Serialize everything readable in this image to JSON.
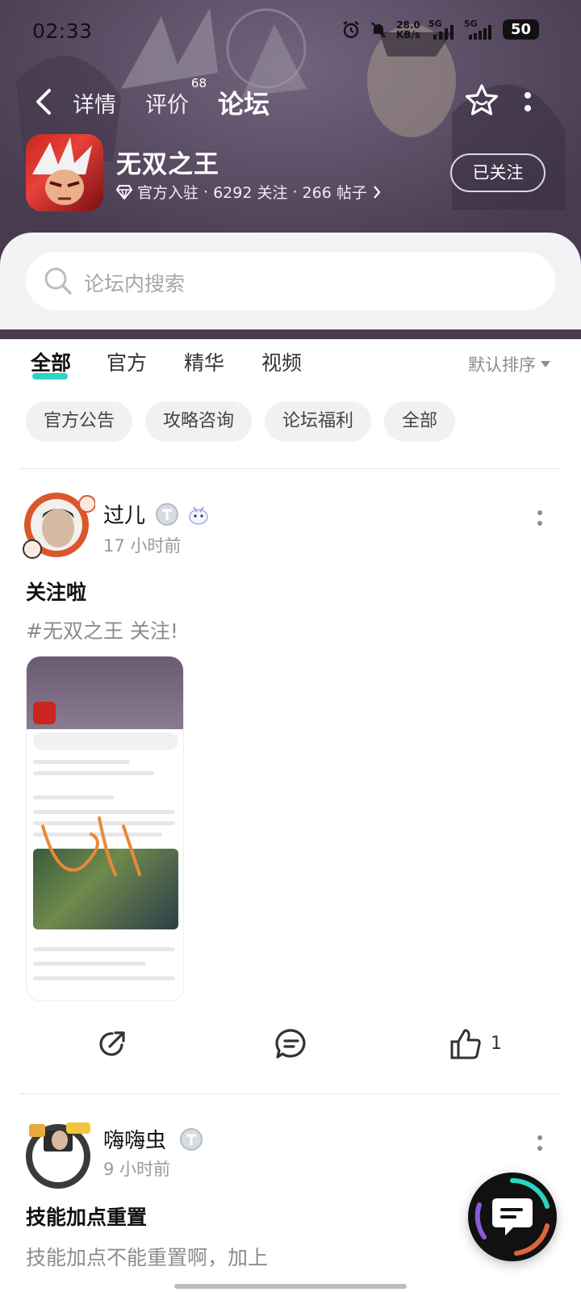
{
  "status_bar": {
    "time": "02:33",
    "net_speed_value": "28.0",
    "net_speed_unit": "KB/s",
    "sim1_label": "5G",
    "sim2_label": "5G",
    "battery": "50",
    "icons": [
      "alarm-icon",
      "mute-bell-icon",
      "signal-icon",
      "signal-icon"
    ]
  },
  "nav": {
    "tabs": [
      {
        "label": "详情"
      },
      {
        "label": "评价",
        "badge": "68"
      },
      {
        "label": "论坛",
        "active": true
      }
    ]
  },
  "game": {
    "name": "无双之王",
    "official": "官方入驻",
    "followers": "6292 关注",
    "posts": "266 帖子",
    "separator": "·",
    "follow_label": "已关注"
  },
  "search": {
    "placeholder": "论坛内搜索"
  },
  "filter_tabs": [
    {
      "label": "全部",
      "active": true
    },
    {
      "label": "官方"
    },
    {
      "label": "精华"
    },
    {
      "label": "视频"
    }
  ],
  "sort_label": "默认排序",
  "chips": [
    "官方公告",
    "攻略咨询",
    "论坛福利",
    "全部"
  ],
  "posts": [
    {
      "user": "过儿",
      "time": "17 小时前",
      "title": "关注啦",
      "body": "#无双之王 关注!",
      "likes": "1"
    },
    {
      "user": "嗨嗨虫",
      "time": "9 小时前",
      "title": "技能加点重置",
      "body": "技能加点不能重置啊，加上"
    }
  ],
  "colors": {
    "accent": "#2dd3c5",
    "header_bg": "#6b5c73"
  }
}
